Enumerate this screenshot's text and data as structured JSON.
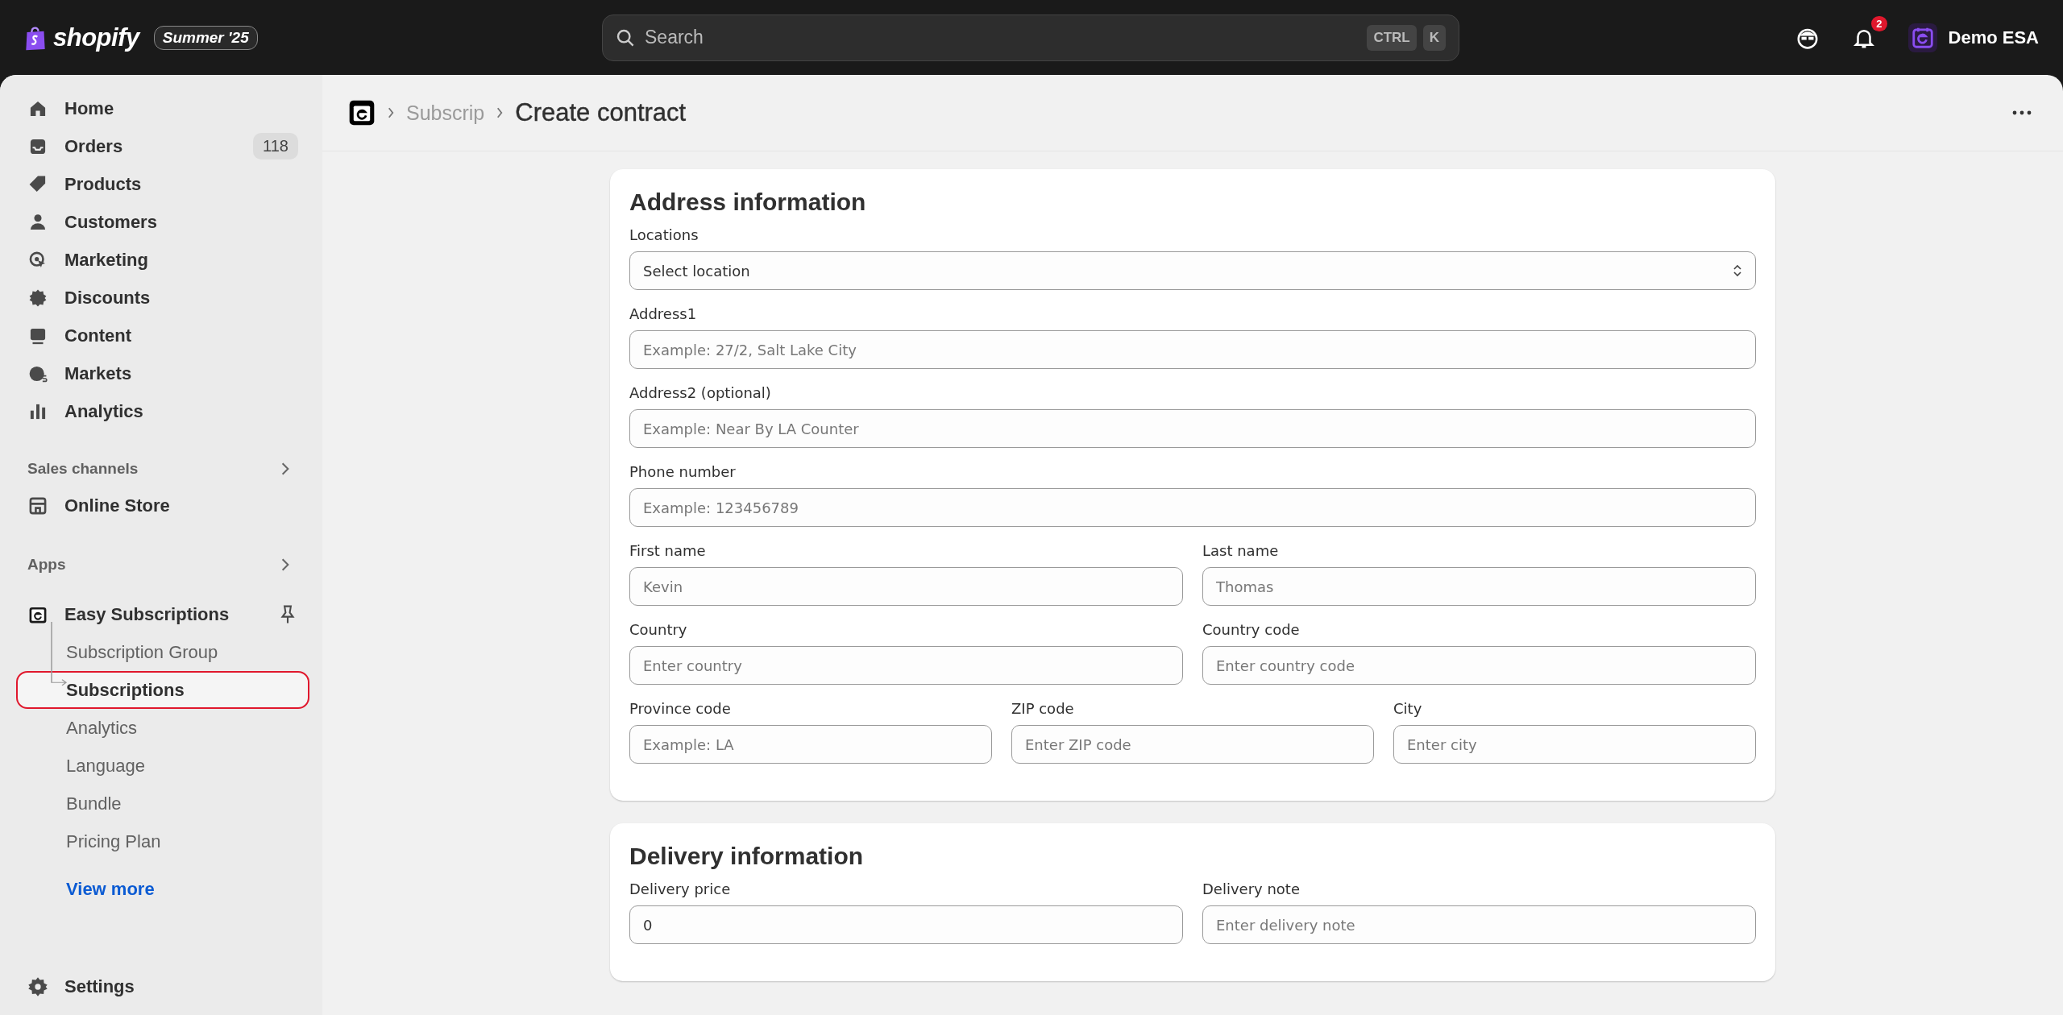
{
  "topbar": {
    "brand": "shopify",
    "edition": "Summer '25",
    "search": {
      "placeholder": "Search"
    },
    "shortcut": [
      "CTRL",
      "K"
    ],
    "notification_count": "2",
    "user": "Demo ESA"
  },
  "sidebar": {
    "items": [
      {
        "label": "Home"
      },
      {
        "label": "Orders",
        "badge": "118"
      },
      {
        "label": "Products"
      },
      {
        "label": "Customers"
      },
      {
        "label": "Marketing"
      },
      {
        "label": "Discounts"
      },
      {
        "label": "Content"
      },
      {
        "label": "Markets"
      },
      {
        "label": "Analytics"
      }
    ],
    "sales_channels": {
      "title": "Sales channels",
      "items": [
        {
          "label": "Online Store"
        }
      ]
    },
    "apps": {
      "title": "Apps",
      "app": {
        "label": "Easy Subscriptions",
        "pinned": true,
        "children": [
          {
            "label": "Subscription Group",
            "selected": false
          },
          {
            "label": "Subscriptions",
            "selected": true
          },
          {
            "label": "Analytics",
            "selected": false
          },
          {
            "label": "Language",
            "selected": false
          },
          {
            "label": "Bundle",
            "selected": false
          },
          {
            "label": "Pricing Plan",
            "selected": false
          }
        ]
      },
      "view_more": "View more"
    },
    "settings": "Settings"
  },
  "page": {
    "breadcrumb": "Subscrip",
    "title": "Create contract",
    "cards": [
      {
        "title": "Address information",
        "rows": [
          [
            {
              "label": "Locations",
              "kind": "select",
              "value": "Select location"
            }
          ],
          [
            {
              "label": "Address1",
              "kind": "text",
              "placeholder": "Example: 27/2, Salt Lake City"
            }
          ],
          [
            {
              "label": "Address2 (optional)",
              "kind": "text",
              "placeholder": "Example: Near By LA Counter"
            }
          ],
          [
            {
              "label": "Phone number",
              "kind": "text",
              "placeholder": "Example: 123456789"
            }
          ],
          [
            {
              "label": "First name",
              "kind": "text",
              "placeholder": "Kevin"
            },
            {
              "label": "Last name",
              "kind": "text",
              "placeholder": "Thomas"
            }
          ],
          [
            {
              "label": "Country",
              "kind": "text",
              "placeholder": "Enter country"
            },
            {
              "label": "Country code",
              "kind": "text",
              "placeholder": "Enter country code"
            }
          ],
          [
            {
              "label": "Province code",
              "kind": "text",
              "placeholder": "Example: LA"
            },
            {
              "label": "ZIP code",
              "kind": "text",
              "placeholder": "Enter ZIP code"
            },
            {
              "label": "City",
              "kind": "text",
              "placeholder": "Enter city"
            }
          ]
        ]
      },
      {
        "title": "Delivery information",
        "rows": [
          [
            {
              "label": "Delivery price",
              "kind": "text",
              "value": "0"
            },
            {
              "label": "Delivery note",
              "kind": "text",
              "placeholder": "Enter delivery note"
            }
          ]
        ]
      }
    ]
  }
}
